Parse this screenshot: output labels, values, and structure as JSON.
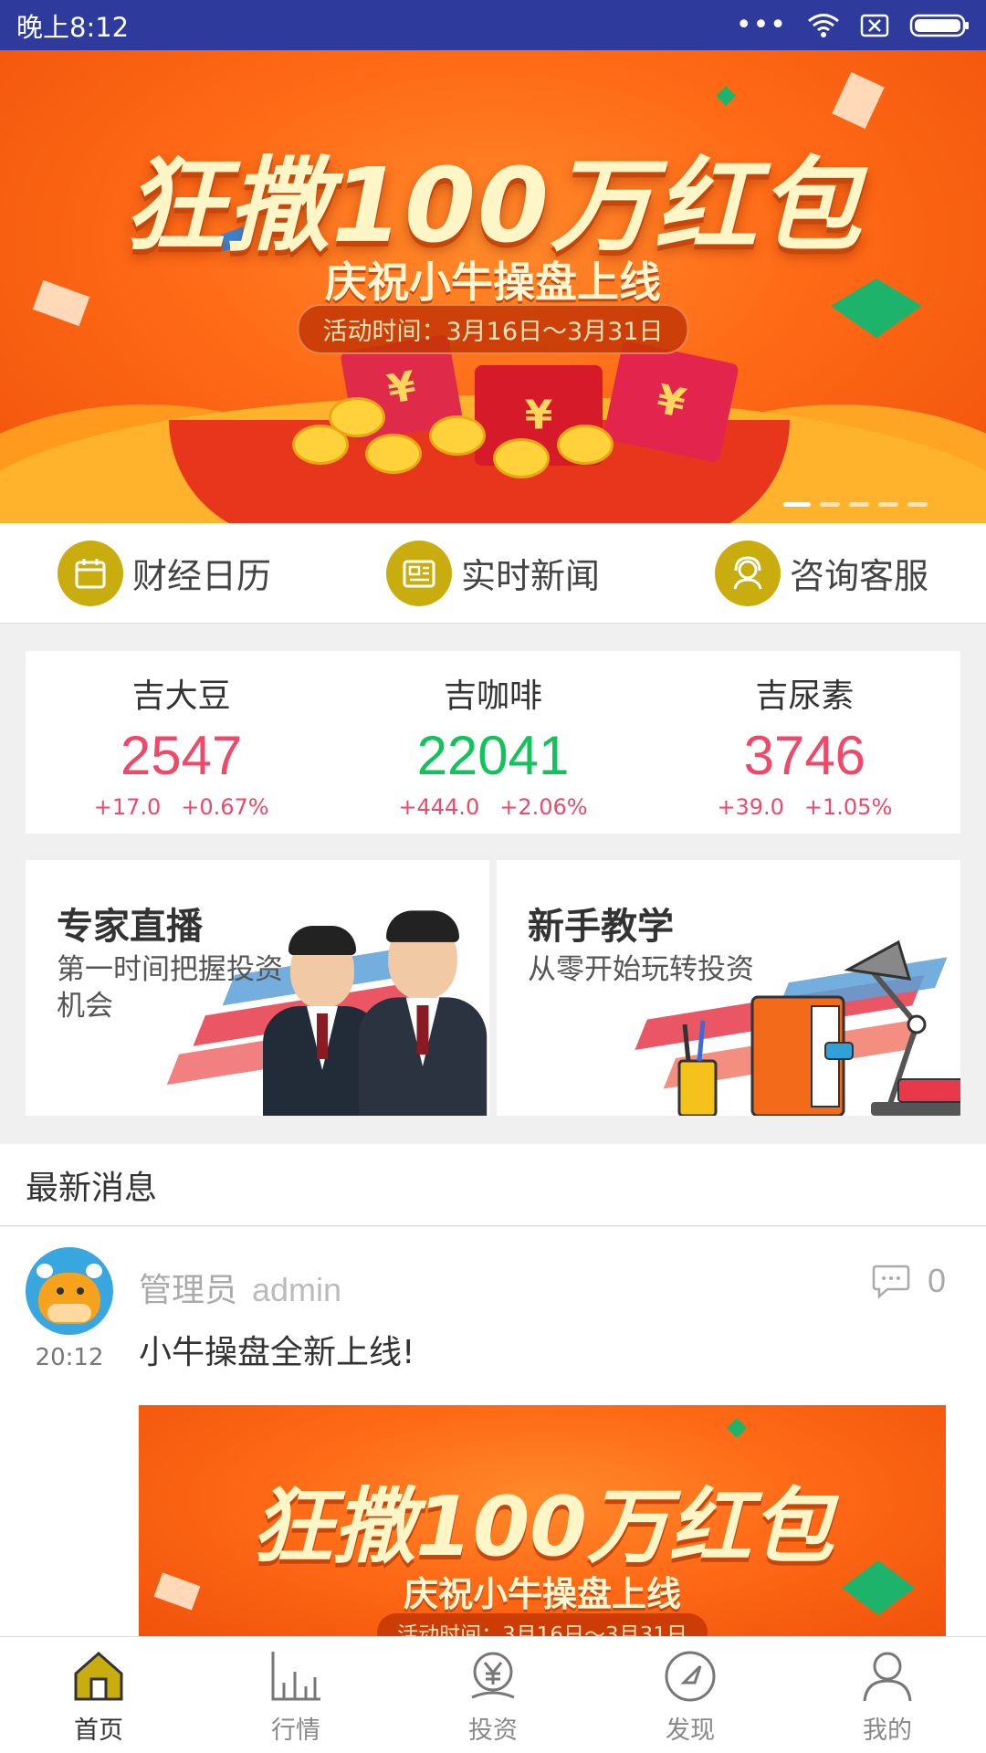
{
  "status_bar": {
    "time": "晚上8:12",
    "icons": [
      "more-dots-icon",
      "wifi-icon",
      "no-sim-icon",
      "battery-icon"
    ]
  },
  "banner": {
    "title": "狂撒100万红包",
    "subtitle": "庆祝小牛操盘上线",
    "period": "活动时间：3月16日～3月31日",
    "slide_count": 5,
    "active_slide": 1
  },
  "quick_nav": [
    {
      "label": "财经日历",
      "icon": "calendar-icon"
    },
    {
      "label": "实时新闻",
      "icon": "newspaper-icon"
    },
    {
      "label": "咨询客服",
      "icon": "customer-service-icon"
    }
  ],
  "quotes": [
    {
      "name": "吉大豆",
      "price": "2547",
      "change": "+17.0",
      "percent": "+0.67%"
    },
    {
      "name": "吉咖啡",
      "price": "22041",
      "change": "+444.0",
      "percent": "+2.06%"
    },
    {
      "name": "吉尿素",
      "price": "3746",
      "change": "+39.0",
      "percent": "+1.05%"
    }
  ],
  "promos": [
    {
      "title": "专家直播",
      "desc": "第一时间把握投资机会"
    },
    {
      "title": "新手教学",
      "desc": "从零开始玩转投资"
    }
  ],
  "news": {
    "section_title": "最新消息",
    "item": {
      "author": "管理员",
      "username": "admin",
      "time": "20:12",
      "comments": "0",
      "text": "小牛操盘全新上线!",
      "image_title": "狂撒100万红包",
      "image_subtitle": "庆祝小牛操盘上线",
      "image_period": "活动时间：3月16日～3月31日"
    }
  },
  "bottom_nav": [
    {
      "label": "首页",
      "icon": "home-icon",
      "active": true
    },
    {
      "label": "行情",
      "icon": "market-chart-icon",
      "active": false
    },
    {
      "label": "投资",
      "icon": "invest-yen-icon",
      "active": false
    },
    {
      "label": "发现",
      "icon": "discover-compass-icon",
      "active": false
    },
    {
      "label": "我的",
      "icon": "profile-icon",
      "active": false
    }
  ],
  "colors": {
    "status_bar": "#2e3b9c",
    "accent_gold": "#c9ad0e",
    "price_up_red": "#ef4868",
    "price_up_green": "#10c35a",
    "banner_orange": "#ff6a16"
  }
}
